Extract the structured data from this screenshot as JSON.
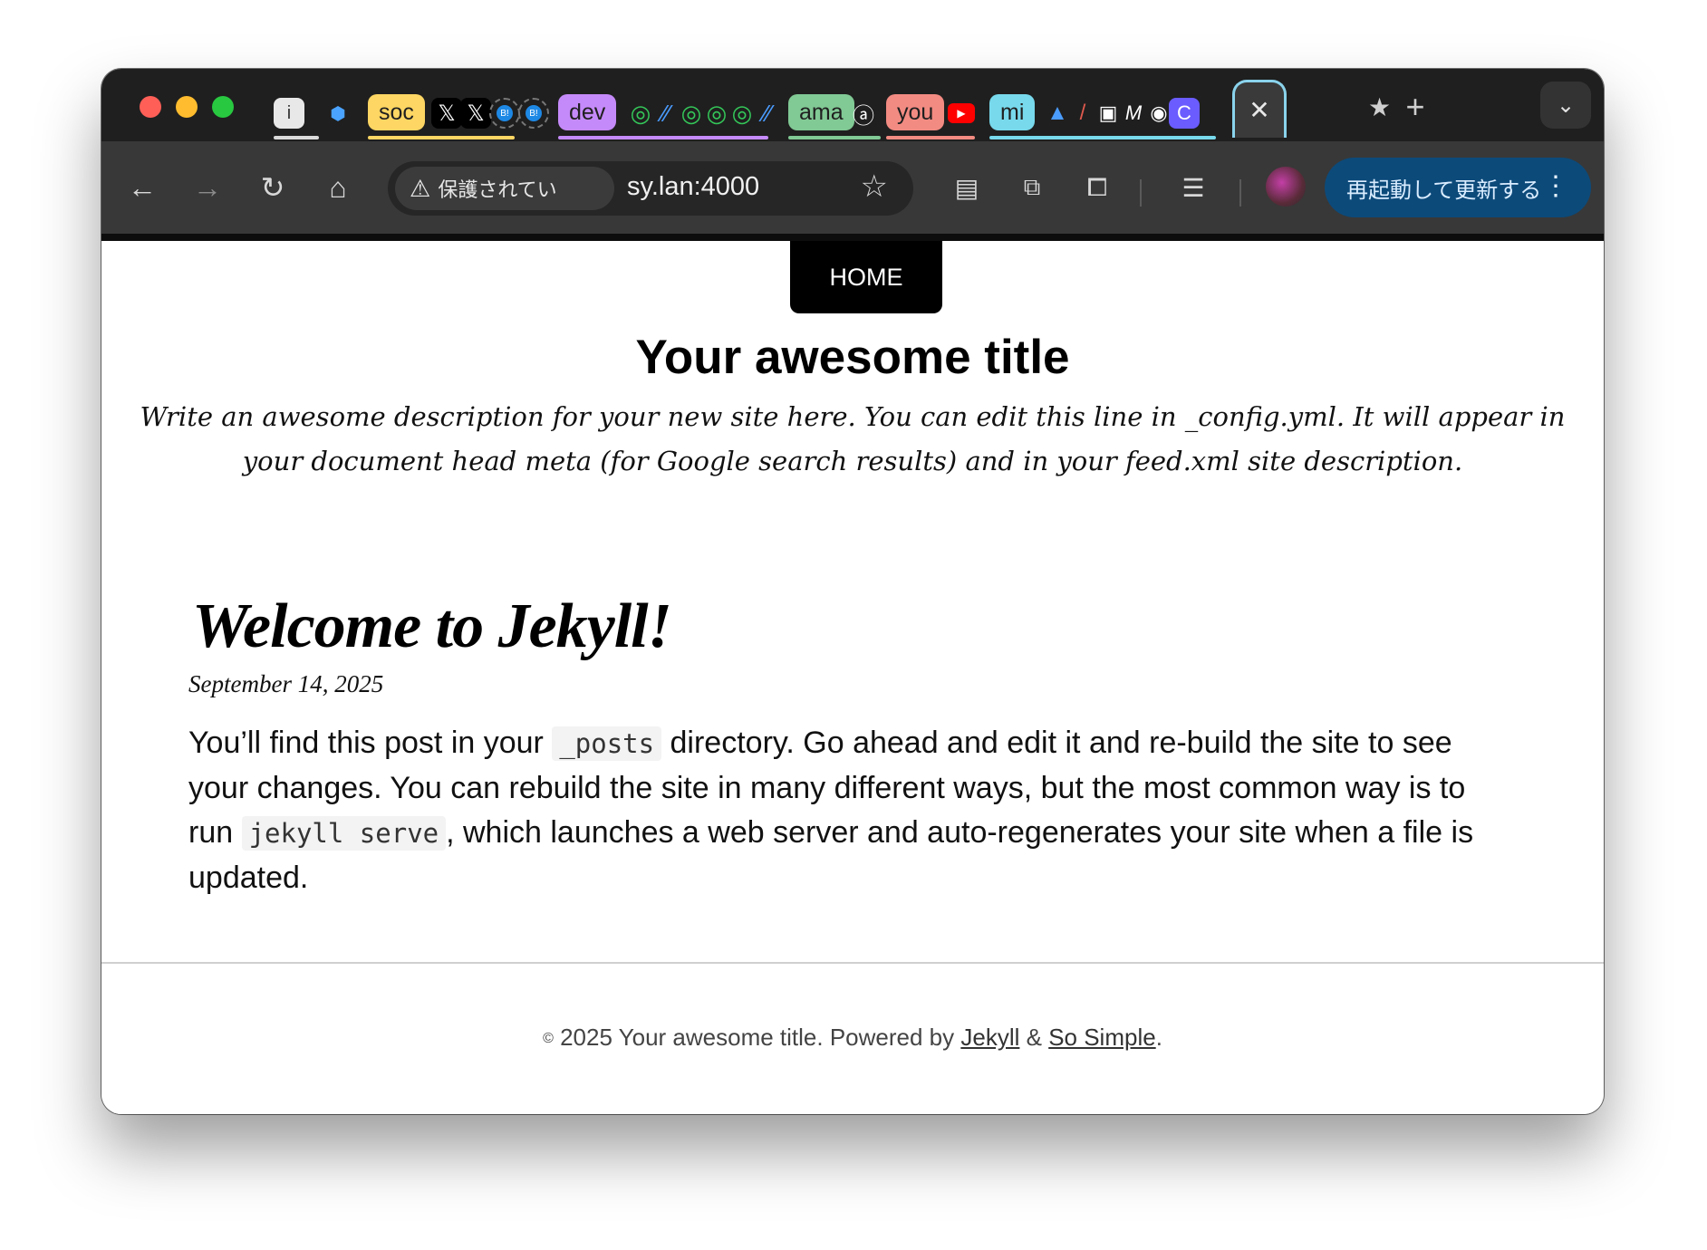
{
  "browser": {
    "tabs": [
      {
        "type": "icon",
        "label": "i",
        "bg": "#e8e8e8",
        "fg": "#333"
      },
      {
        "type": "icon",
        "label": "🎲",
        "bg": "#1f1f1f",
        "fg": "#fff"
      },
      {
        "type": "group",
        "label": "soc",
        "bg": "#fdd663"
      },
      {
        "type": "icon",
        "label": "𝕏",
        "bg": "#000",
        "fg": "#fff"
      },
      {
        "type": "icon",
        "label": "𝕏",
        "bg": "#000",
        "fg": "#fff"
      },
      {
        "type": "icon",
        "label": "B!",
        "bg": "#1f1f1f",
        "fg": "#fff"
      },
      {
        "type": "icon",
        "label": "B!",
        "bg": "#1f1f1f",
        "fg": "#fff"
      },
      {
        "type": "group",
        "label": "dev",
        "bg": "#c58af9"
      },
      {
        "type": "group",
        "label": "ama",
        "bg": "#81c995"
      },
      {
        "type": "group",
        "label": "you",
        "bg": "#f28b82"
      },
      {
        "type": "group",
        "label": "mi",
        "bg": "#78d9ec"
      }
    ],
    "active_tab_close": "✕",
    "new_tab": "+",
    "security_label": "保護されてい",
    "url": "sy.lan:4000",
    "update_button": "再起動して更新する"
  },
  "page": {
    "nav": {
      "home": "HOME"
    },
    "site_title": "Your awesome title",
    "site_description": "Write an awesome description for your new site here. You can edit this line in _config.yml. It will appear in your document head meta (for Google search results) and in your feed.xml site description.",
    "post": {
      "title": "Welcome to Jekyll!",
      "date": "September 14, 2025",
      "body_1": "You’ll find this post in your ",
      "code_1": "_posts",
      "body_2": " directory. Go ahead and edit it and re-build the site to see your changes. You can rebuild the site in many different ways, but the most common way is to run ",
      "code_2": "jekyll serve",
      "body_3": ", which launches a web server and auto-regenerates your site when a file is updated."
    },
    "footer": {
      "copyright_symbol": "©",
      "text": " 2025 Your awesome title. Powered by ",
      "link_1": "Jekyll",
      "amp": " & ",
      "link_2": "So Simple",
      "end": "."
    }
  }
}
